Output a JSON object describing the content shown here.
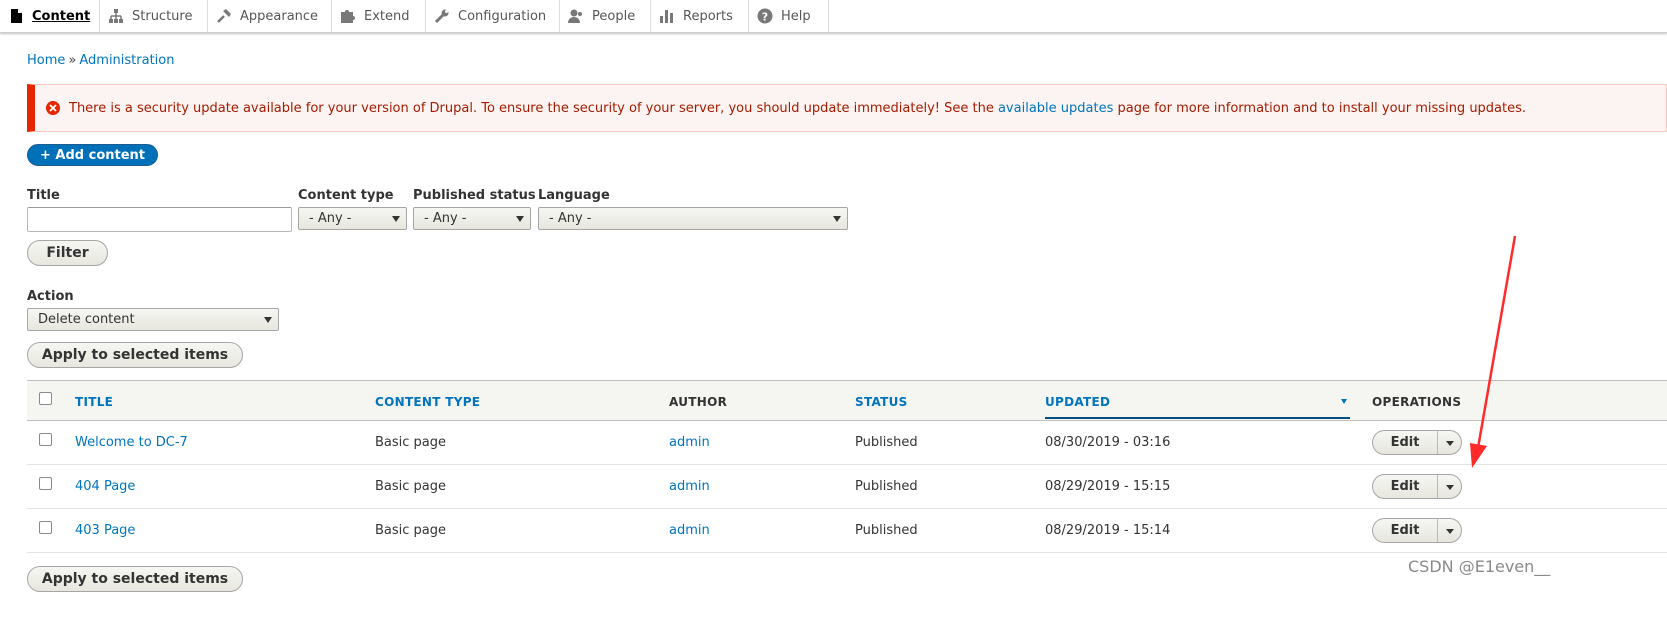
{
  "toolbar": {
    "items": [
      {
        "label": "Content",
        "icon": "content-icon",
        "active": true
      },
      {
        "label": "Structure",
        "icon": "structure-icon"
      },
      {
        "label": "Appearance",
        "icon": "appearance-icon"
      },
      {
        "label": "Extend",
        "icon": "extend-icon"
      },
      {
        "label": "Configuration",
        "icon": "configuration-icon"
      },
      {
        "label": "People",
        "icon": "people-icon"
      },
      {
        "label": "Reports",
        "icon": "reports-icon"
      },
      {
        "label": "Help",
        "icon": "help-icon"
      }
    ]
  },
  "breadcrumb": {
    "home": "Home",
    "separator": "»",
    "admin": "Administration"
  },
  "message": {
    "type": "error",
    "text_before": "There is a security update available for your version of Drupal. To ensure the security of your server, you should update immediately! See the",
    "link": "available updates",
    "text_after": "page for more information and to install your missing updates."
  },
  "add_content": "+ Add content",
  "filters": {
    "title_label": "Title",
    "title_value": "",
    "content_type_label": "Content type",
    "content_type_value": "- Any -",
    "status_label": "Published status",
    "status_value": "- Any -",
    "language_label": "Language",
    "language_value": "- Any -",
    "filter_button": "Filter"
  },
  "bulk": {
    "action_label": "Action",
    "action_value": "Delete content",
    "apply_button": "Apply to selected items"
  },
  "table": {
    "headers": {
      "title": "Title",
      "content_type": "Content type",
      "author": "Author",
      "status": "Status",
      "updated": "Updated",
      "operations": "Operations"
    },
    "rows": [
      {
        "title": "Welcome to DC-7",
        "type": "Basic page",
        "author": "admin",
        "status": "Published",
        "updated": "08/30/2019 - 03:16",
        "op": "Edit"
      },
      {
        "title": "404 Page",
        "type": "Basic page",
        "author": "admin",
        "status": "Published",
        "updated": "08/29/2019 - 15:15",
        "op": "Edit"
      },
      {
        "title": "403 Page",
        "type": "Basic page",
        "author": "admin",
        "status": "Published",
        "updated": "08/29/2019 - 15:14",
        "op": "Edit"
      }
    ]
  },
  "watermark": "CSDN @E1even__",
  "colors": {
    "link": "#0074bd",
    "error_border": "#e62600",
    "error_bg": "#fcf4f2",
    "primary_button": "#0071b8",
    "annotation_arrow": "#ff2a2a"
  }
}
